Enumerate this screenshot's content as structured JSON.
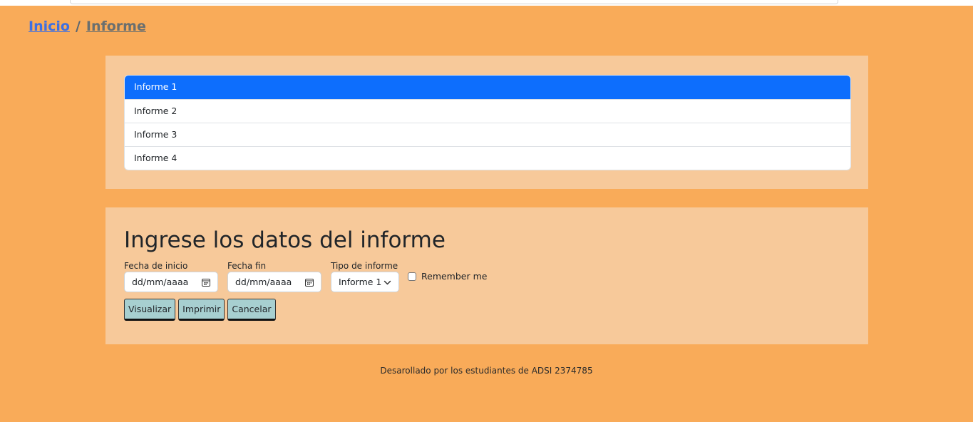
{
  "breadcrumb": {
    "home": "Inicio",
    "separator": "/",
    "current": "Informe"
  },
  "reports_list": {
    "items": [
      {
        "label": "Informe 1",
        "active": true
      },
      {
        "label": "Informe 2",
        "active": false
      },
      {
        "label": "Informe 3",
        "active": false
      },
      {
        "label": "Informe 4",
        "active": false
      }
    ]
  },
  "form": {
    "title": "Ingrese los datos del informe",
    "start_date": {
      "label": "Fecha de inicio",
      "placeholder": "dd/mm/aaaa"
    },
    "end_date": {
      "label": "Fecha fin",
      "placeholder": "dd/mm/aaaa"
    },
    "report_type": {
      "label": "Tipo de informe",
      "value": "Informe 1"
    },
    "remember": {
      "label": "Remember me",
      "checked": false
    },
    "buttons": {
      "view": "Visualizar",
      "print": "Imprimir",
      "cancel": "Cancelar"
    }
  },
  "footer": {
    "text": "Desarollado por los estudiantes de ADSI 2374785"
  },
  "colors": {
    "page_background": "#f9ab59",
    "card_background": "#f7c99a",
    "active_item": "#0d6efd",
    "button_background": "#a7cfd0",
    "link": "#3d6fe3"
  }
}
